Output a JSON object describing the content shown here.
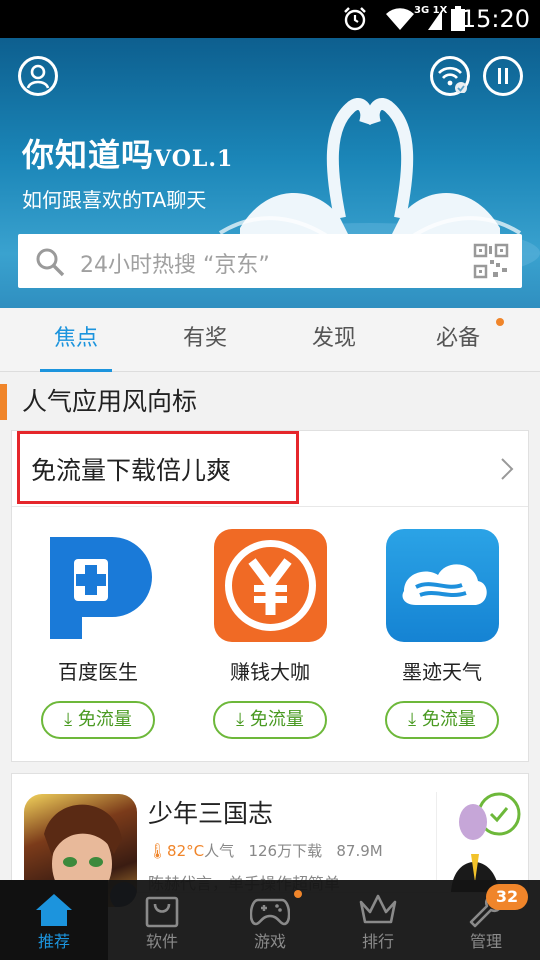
{
  "status_bar": {
    "time": "15:20",
    "network": "3G 1X"
  },
  "hero": {
    "title": "你知道吗",
    "title_suffix": "VOL.1",
    "subtitle": "如何跟喜欢的TA聊天",
    "search_placeholder": "24小时热搜 “京东”"
  },
  "tabs": [
    {
      "label": "焦点",
      "active": true
    },
    {
      "label": "有奖",
      "active": false
    },
    {
      "label": "发现",
      "active": false
    },
    {
      "label": "必备",
      "active": false,
      "dot": true
    }
  ],
  "section": {
    "title": "人气应用风向标",
    "headline": "免流量下载倍儿爽",
    "apps": [
      {
        "name": "百度医生",
        "button": "免流量",
        "icon": "plus-icon"
      },
      {
        "name": "赚钱大咖",
        "button": "免流量",
        "icon": "yen-icon"
      },
      {
        "name": "墨迹天气",
        "button": "免流量",
        "icon": "cloud-icon"
      }
    ]
  },
  "game_card": {
    "title": "少年三国志",
    "temperature": "82°C",
    "popularity_label": "人气",
    "downloads": "126万下载",
    "size": "87.9M",
    "description": "陈赫代言，单手操作超简单"
  },
  "bottom_nav": [
    {
      "label": "推荐",
      "active": true,
      "icon": "home-icon"
    },
    {
      "label": "软件",
      "active": false,
      "icon": "bag-icon"
    },
    {
      "label": "游戏",
      "active": false,
      "icon": "gamepad-icon"
    },
    {
      "label": "排行",
      "active": false,
      "icon": "crown-icon"
    },
    {
      "label": "管理",
      "active": false,
      "icon": "wrench-icon"
    }
  ],
  "badges": {
    "manage_count": "32"
  },
  "colors": {
    "accent": "#1c94dd",
    "orange": "#f0852a",
    "green": "#6db83a",
    "highlight_box": "#e5262b"
  }
}
